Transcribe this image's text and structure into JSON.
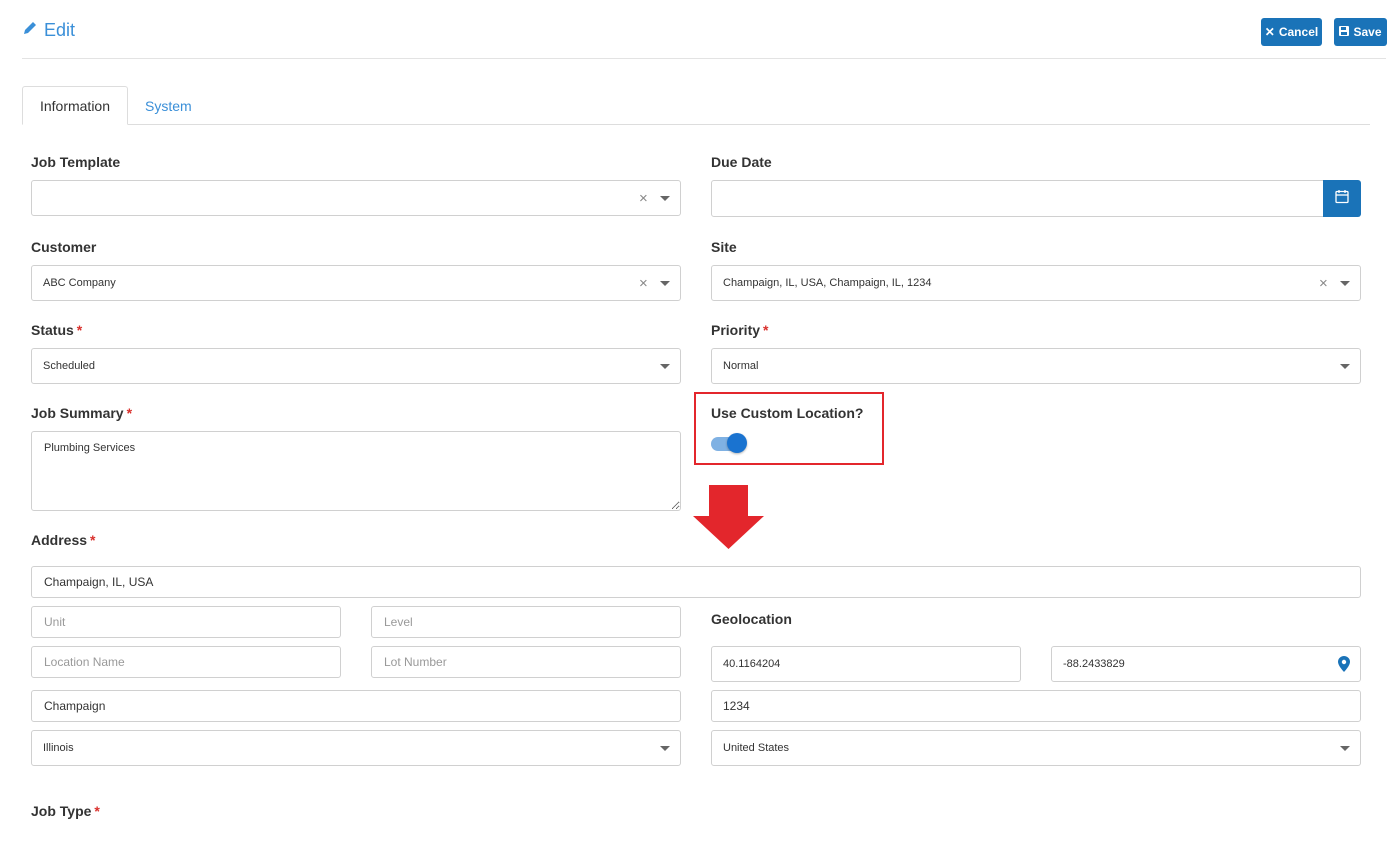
{
  "header": {
    "title": "Edit",
    "cancel_label": "Cancel",
    "save_label": "Save"
  },
  "tabs": [
    {
      "label": "Information",
      "active": true
    },
    {
      "label": "System",
      "active": false
    }
  ],
  "form": {
    "job_template": {
      "label": "Job Template",
      "value": ""
    },
    "due_date": {
      "label": "Due Date",
      "value": ""
    },
    "customer": {
      "label": "Customer",
      "value": "ABC Company"
    },
    "site": {
      "label": "Site",
      "value": "Champaign, IL, USA, Champaign, IL, 1234"
    },
    "status": {
      "label": "Status",
      "required": "*",
      "value": "Scheduled"
    },
    "priority": {
      "label": "Priority",
      "required": "*",
      "value": "Normal"
    },
    "job_summary": {
      "label": "Job Summary",
      "required": "*",
      "value": "Plumbing Services"
    },
    "custom_location": {
      "label": "Use Custom Location?",
      "enabled": true
    },
    "address": {
      "label": "Address",
      "required": "*",
      "line": "Champaign, IL, USA",
      "unit_placeholder": "Unit",
      "level_placeholder": "Level",
      "location_name_placeholder": "Location Name",
      "lot_number_placeholder": "Lot Number",
      "city": "Champaign",
      "state": "Illinois",
      "postcode": "1234",
      "country": "United States"
    },
    "geolocation": {
      "label": "Geolocation",
      "latitude": "40.1164204",
      "longitude": "-88.2433829"
    },
    "job_type": {
      "label": "Job Type",
      "required": "*"
    }
  },
  "colors": {
    "accent": "#1a73b8",
    "highlight": "#e3262c",
    "required": "#d9302c"
  }
}
